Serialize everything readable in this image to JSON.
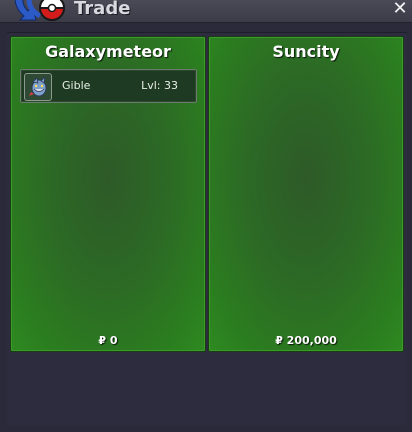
{
  "window": {
    "title": "Trade",
    "close_icon": "close-icon",
    "title_icon": "pokeball-arrow-icon"
  },
  "colors": {
    "panel_green": "#2c7a22",
    "panel_center": "#2e5a28",
    "window_bg": "#2a2a3b",
    "titlebar": "#44444f"
  },
  "trade": {
    "left": {
      "player": "Galaxymeteor",
      "items": [
        {
          "name": "Gible",
          "level": "Lvl: 33",
          "icon": "gible-icon"
        }
      ],
      "money": "₽ 0"
    },
    "right": {
      "player": "Suncity",
      "items": [],
      "money": "₽ 200,000"
    }
  }
}
